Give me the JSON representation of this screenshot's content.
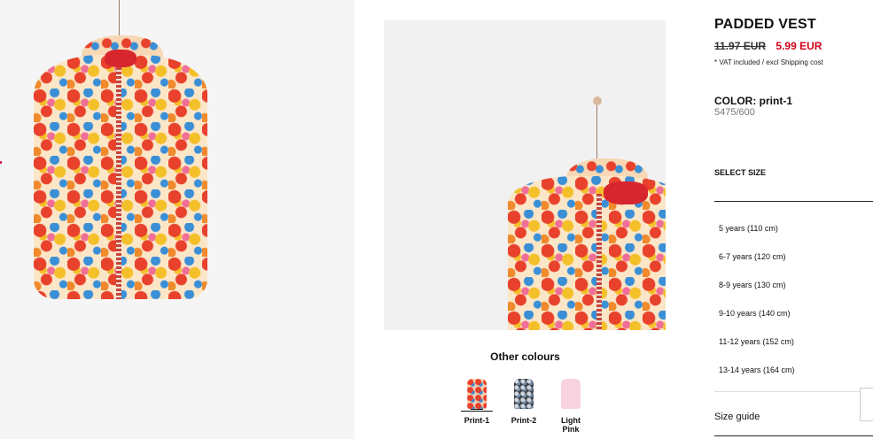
{
  "product": {
    "title": "PADDED VEST",
    "old_price": "11.97 EUR",
    "new_price": "5.99 EUR",
    "vat_note": "* VAT included / excl Shipping cost",
    "color_label": "COLOR: print-1",
    "ref_code": "5475/600"
  },
  "other_colours": {
    "title": "Other colours",
    "items": [
      {
        "label": "Print-1",
        "selected": true
      },
      {
        "label": "Print-2",
        "selected": false
      },
      {
        "label": "Light Pink",
        "selected": false
      }
    ]
  },
  "size_selector": {
    "title": "SELECT SIZE",
    "sizes": [
      "5 years (110 cm)",
      "6-7 years (120 cm)",
      "8-9 years (130 cm)",
      "9-10 years (140 cm)",
      "11-12 years (152 cm)",
      "13-14 years (164 cm)"
    ],
    "guide_label": "Size guide"
  },
  "colors": {
    "accent_red": "#d0021b",
    "vest_zip_red": "#d8262e"
  }
}
